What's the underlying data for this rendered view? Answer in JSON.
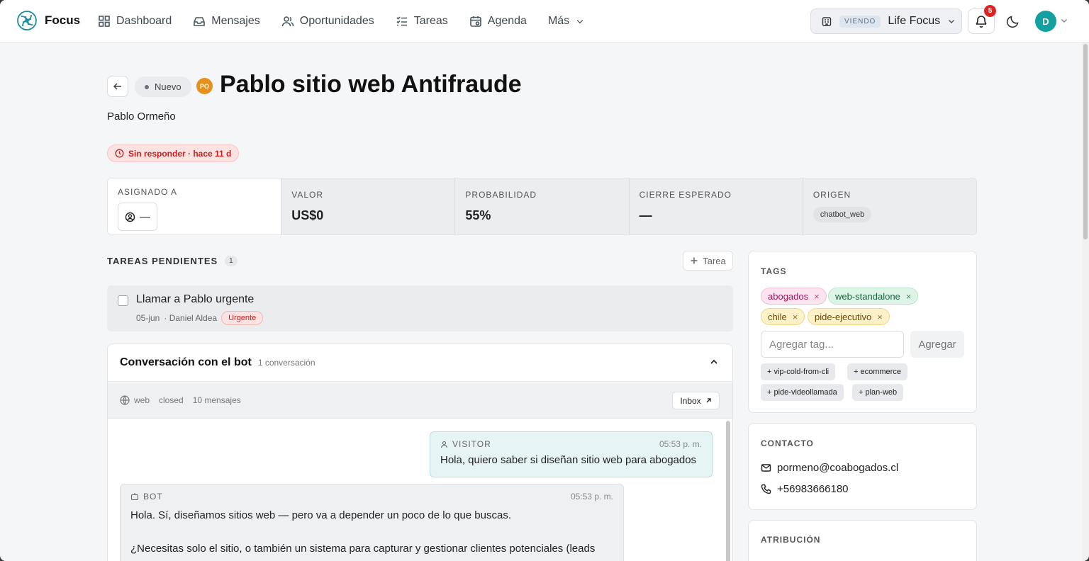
{
  "brand": {
    "name": "Focus",
    "icon": "focus-logo-icon"
  },
  "nav": {
    "items": [
      {
        "label": "Dashboard",
        "icon": "grid-icon"
      },
      {
        "label": "Mensajes",
        "icon": "inbox-icon"
      },
      {
        "label": "Oportunidades",
        "icon": "users-icon"
      },
      {
        "label": "Tareas",
        "icon": "checklist-icon"
      },
      {
        "label": "Agenda",
        "icon": "calendar-icon"
      },
      {
        "label": "Más",
        "icon": "chevron-down-icon"
      }
    ]
  },
  "viewing": {
    "badge": "VIENDO",
    "name": "Life Focus"
  },
  "notifications": {
    "count": "5"
  },
  "user": {
    "initial": "D"
  },
  "lead": {
    "status": "Nuevo",
    "owner_initials": "PO",
    "title": "Pablo sitio web Antifraude",
    "contact_name": "Pablo Ormeño",
    "alert": "Sin responder · hace 11 d"
  },
  "stats": {
    "assigned": {
      "label": "ASIGNADO A",
      "value": "—"
    },
    "value": {
      "label": "VALOR",
      "value": "US$0"
    },
    "probability": {
      "label": "PROBABILIDAD",
      "value": "55%"
    },
    "close": {
      "label": "CIERRE ESPERADO",
      "value": "—"
    },
    "origin": {
      "label": "ORIGEN",
      "value": "chatbot_web"
    }
  },
  "tasks": {
    "title": "TAREAS PENDIENTES",
    "count": "1",
    "add_label": "Tarea",
    "items": [
      {
        "title": "Llamar a Pablo urgente",
        "date": "05-jun",
        "owner": "· Daniel Aldea",
        "badge": "Urgente"
      }
    ]
  },
  "conversation": {
    "title": "Conversación con el bot",
    "subtitle": "1 conversación",
    "channel": "web",
    "state": "closed",
    "messages_count": "10 mensajes",
    "inbox_label": "Inbox",
    "messages": [
      {
        "role": "VISITOR",
        "time": "05:53 p. m.",
        "text": "Hola, quiero saber si diseñan sitio web para abogados"
      },
      {
        "role": "BOT",
        "time": "05:53 p. m.",
        "text": "Hola. Sí, diseñamos sitios web — pero va a depender un poco de lo que buscas.",
        "text2": "¿Necesitas solo el sitio, o también un sistema para capturar y gestionar clientes potenciales (leads"
      }
    ]
  },
  "tags": {
    "label": "TAGS",
    "items": [
      {
        "label": "abogados",
        "color": "#fbe3ef"
      },
      {
        "label": "web-standalone",
        "color": "#dff4e8"
      },
      {
        "label": "chile",
        "color": "#fdf1c9"
      },
      {
        "label": "pide-ejecutivo",
        "color": "#fdf1c9"
      }
    ],
    "input_placeholder": "Agregar tag...",
    "add_label": "Agregar",
    "suggestions": [
      "+ vip-cold-from-cli",
      "+ ecommerce",
      "+ pide-videollamada",
      "+ plan-web"
    ]
  },
  "contact": {
    "label": "CONTACTO",
    "email": "pormeno@coabogados.cl",
    "phone": "+56983666180"
  },
  "attribution": {
    "label": "ATRIBUCIÓN"
  }
}
